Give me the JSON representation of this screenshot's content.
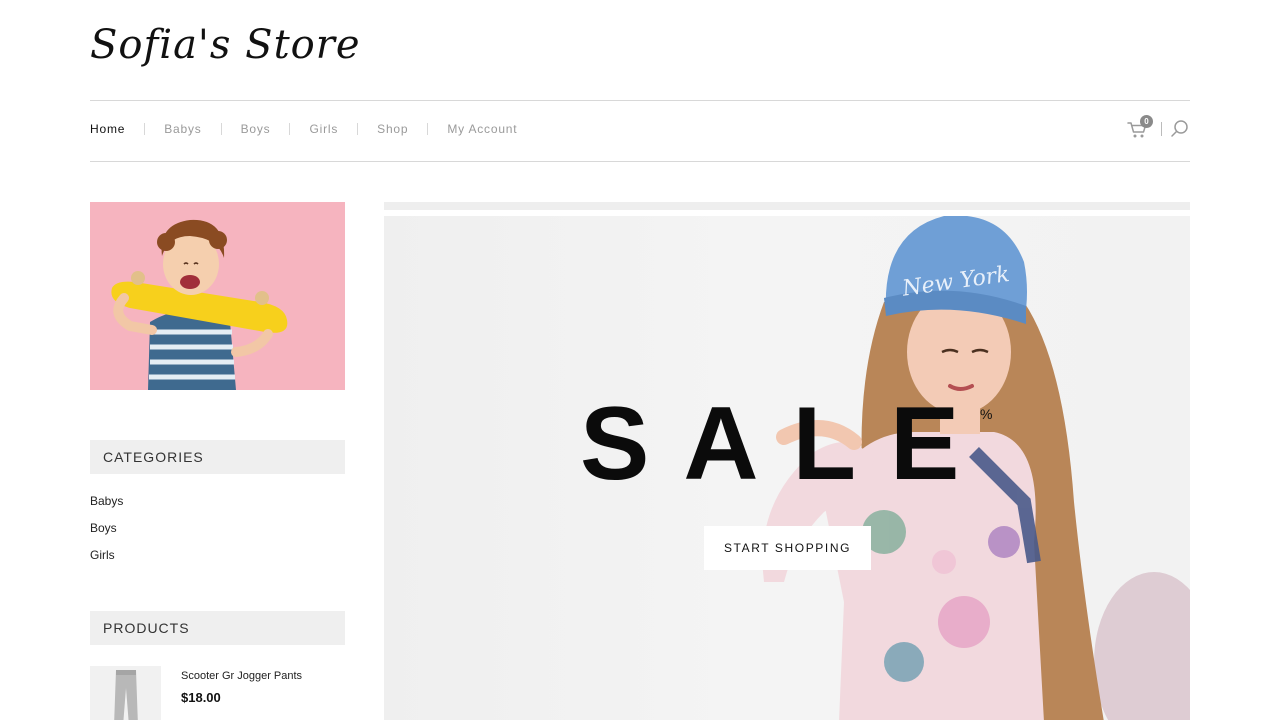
{
  "header": {
    "logo": "Sofia's Store"
  },
  "nav": {
    "items": [
      {
        "label": "Home",
        "active": true
      },
      {
        "label": "Babys",
        "active": false
      },
      {
        "label": "Boys",
        "active": false
      },
      {
        "label": "Girls",
        "active": false
      },
      {
        "label": "Shop",
        "active": false
      },
      {
        "label": "My Account",
        "active": false
      }
    ],
    "cart_count": "0",
    "icons": [
      "cart-icon",
      "search-icon"
    ]
  },
  "sidebar": {
    "categories_title": "CATEGORIES",
    "categories": [
      "Babys",
      "Boys",
      "Girls"
    ],
    "products_title": "PRODUCTS",
    "products": [
      {
        "name": "Scooter Gr Jogger Pants",
        "price": "$18.00"
      }
    ]
  },
  "hero": {
    "headline": "SALE",
    "superscript": "%",
    "cta_label": "START SHOPPING"
  },
  "colors": {
    "promo_bg": "#f6b4bf",
    "skateboard": "#f7d01c",
    "beanie": "#6f9fd6",
    "nav_inactive": "#9a9a9a",
    "widget_bg": "#efefef"
  }
}
